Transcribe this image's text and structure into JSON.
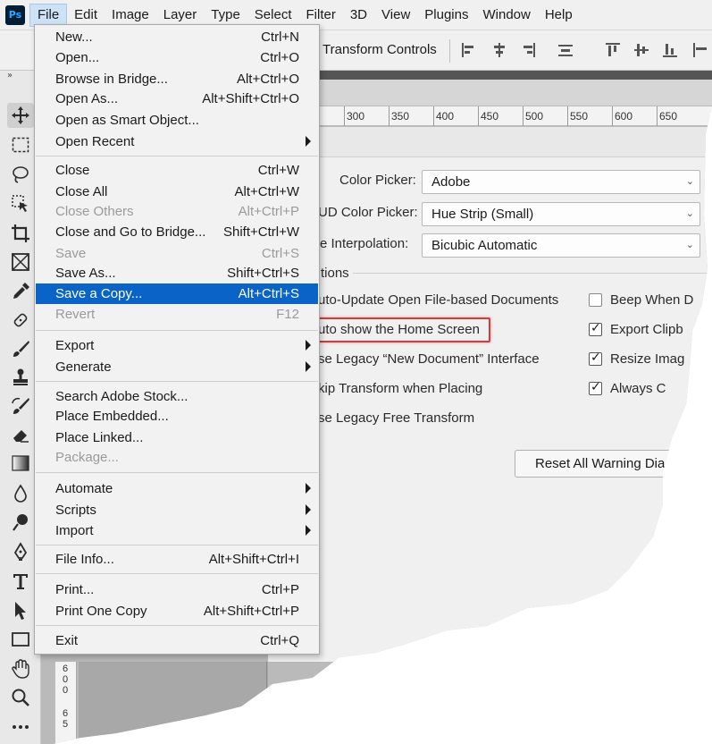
{
  "menubar": {
    "logo": "Ps",
    "items": [
      "File",
      "Edit",
      "Image",
      "Layer",
      "Type",
      "Select",
      "Filter",
      "3D",
      "View",
      "Plugins",
      "Window",
      "Help"
    ]
  },
  "options_bar": {
    "transform_controls": "Transform Controls"
  },
  "ruler": {
    "ticks": [
      "300",
      "350",
      "400",
      "450",
      "500",
      "550",
      "600",
      "650"
    ]
  },
  "vruler": {
    "a": [
      "6",
      "0",
      "0"
    ],
    "b": [
      "6",
      "5"
    ]
  },
  "preferences": {
    "color_picker_label": "Color Picker:",
    "color_picker_value": "Adobe",
    "hud_picker_label": "UD Color Picker:",
    "hud_picker_value": "Hue Strip (Small)",
    "interp_label": "e Interpolation:",
    "interp_value": "Bicubic Automatic",
    "options_section": "tions",
    "left_options": [
      "uto-Update Open File-based Documents",
      "uto show the Home Screen",
      "se Legacy “New Document” Interface",
      "kip Transform when Placing",
      "se Legacy Free Transform"
    ],
    "right_options": [
      {
        "label": "Beep When D",
        "checked": false
      },
      {
        "label": "Export Clipb",
        "checked": true
      },
      {
        "label": "Resize Imag",
        "checked": true
      },
      {
        "label": "Always C",
        "checked": true
      }
    ],
    "reset_button": "Reset All Warning Dia"
  },
  "file_menu": {
    "items": [
      {
        "label": "New...",
        "shortcut": "Ctrl+N"
      },
      {
        "label": "Open...",
        "shortcut": "Ctrl+O"
      },
      {
        "label": "Browse in Bridge...",
        "shortcut": "Alt+Ctrl+O"
      },
      {
        "label": "Open As...",
        "shortcut": "Alt+Shift+Ctrl+O"
      },
      {
        "label": "Open as Smart Object...",
        "shortcut": ""
      },
      {
        "label": "Open Recent",
        "shortcut": "",
        "submenu": true
      },
      {
        "label": "Close",
        "shortcut": "Ctrl+W"
      },
      {
        "label": "Close All",
        "shortcut": "Alt+Ctrl+W"
      },
      {
        "label": "Close Others",
        "shortcut": "Alt+Ctrl+P",
        "disabled": true
      },
      {
        "label": "Close and Go to Bridge...",
        "shortcut": "Shift+Ctrl+W"
      },
      {
        "label": "Save",
        "shortcut": "Ctrl+S",
        "disabled": true
      },
      {
        "label": "Save As...",
        "shortcut": "Shift+Ctrl+S"
      },
      {
        "label": "Save a Copy...",
        "shortcut": "Alt+Ctrl+S",
        "highlighted": true
      },
      {
        "label": "Revert",
        "shortcut": "F12",
        "disabled": true
      },
      {
        "label": "Export",
        "shortcut": "",
        "submenu": true
      },
      {
        "label": "Generate",
        "shortcut": "",
        "submenu": true
      },
      {
        "label": "Search Adobe Stock...",
        "shortcut": ""
      },
      {
        "label": "Place Embedded...",
        "shortcut": ""
      },
      {
        "label": "Place Linked...",
        "shortcut": ""
      },
      {
        "label": "Package...",
        "shortcut": "",
        "disabled": true
      },
      {
        "label": "Automate",
        "shortcut": "",
        "submenu": true
      },
      {
        "label": "Scripts",
        "shortcut": "",
        "submenu": true
      },
      {
        "label": "Import",
        "shortcut": "",
        "submenu": true
      },
      {
        "label": "File Info...",
        "shortcut": "Alt+Shift+Ctrl+I"
      },
      {
        "label": "Print...",
        "shortcut": "Ctrl+P"
      },
      {
        "label": "Print One Copy",
        "shortcut": "Alt+Shift+Ctrl+P"
      },
      {
        "label": "Exit",
        "shortcut": "Ctrl+Q"
      }
    ]
  },
  "colors": {
    "highlight": "#0a64c8",
    "callout": "#d43b3b"
  }
}
